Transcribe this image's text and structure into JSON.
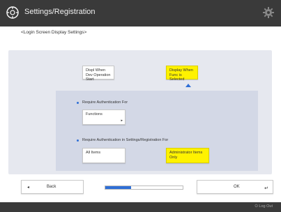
{
  "header": {
    "title": "Settings/Registration",
    "app_icon": "settings-registration-icon",
    "gear_icon": "gear-icon"
  },
  "subtitle": "<Login Screen Display Settings>",
  "options": {
    "display_when_operation_start": "Displ When Dev Operation Start",
    "display_when_func_selected": "Display When Func is Selected"
  },
  "auth_for": {
    "label": "Require Authentication For",
    "functions_button": "Functions"
  },
  "auth_settings": {
    "label": "Require Authentication in Settings/Registration For",
    "all_items": "All Items",
    "admin_only": "Administrator Items Only"
  },
  "footer": {
    "back": "Back",
    "ok": "OK",
    "progress": 0.33,
    "logout": "Log Out"
  },
  "colors": {
    "accent": "#2f6fd6",
    "selected": "#fff200",
    "titlebar": "#3a3a3a"
  }
}
